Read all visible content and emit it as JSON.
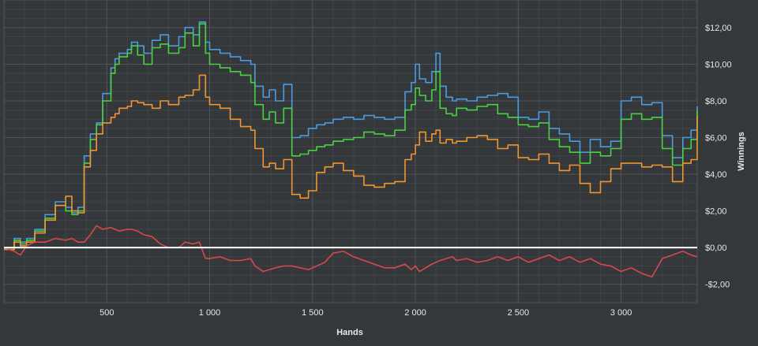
{
  "colors": {
    "background": "#35383b",
    "plot_background": "#35383b",
    "grid_major": "#505458",
    "grid_minor": "#414447",
    "axis_text": "#e8e8e8",
    "zero_line": "#ffffff"
  },
  "chart_data": {
    "type": "line",
    "xlabel": "Hands",
    "ylabel": "Winnings",
    "xlim": [
      0,
      3370
    ],
    "ylim": [
      -3.0,
      13.5
    ],
    "x_ticks": [
      500,
      1000,
      1500,
      2000,
      2500,
      3000
    ],
    "x_tick_labels": [
      "500",
      "1 000",
      "1 500",
      "2 000",
      "2 500",
      "3 000"
    ],
    "y_ticks": [
      -2,
      0,
      2,
      4,
      6,
      8,
      10,
      12
    ],
    "y_tick_labels": [
      "-$2,00",
      "$0,00",
      "$2,00",
      "$4,00",
      "$6,00",
      "$8,00",
      "$10,00",
      "$12,00"
    ],
    "y_axis_side": "right",
    "grid": true,
    "legend": "none",
    "zero_line": true,
    "series": [
      {
        "color": "#4a9be0",
        "step": true,
        "x": [
          0,
          50,
          80,
          110,
          150,
          200,
          250,
          300,
          330,
          360,
          390,
          420,
          450,
          480,
          520,
          540,
          560,
          600,
          620,
          650,
          680,
          720,
          760,
          800,
          850,
          880,
          920,
          950,
          980,
          1000,
          1050,
          1100,
          1150,
          1200,
          1220,
          1260,
          1290,
          1320,
          1360,
          1400,
          1440,
          1480,
          1520,
          1560,
          1600,
          1650,
          1700,
          1750,
          1800,
          1850,
          1900,
          1950,
          1980,
          2000,
          2020,
          2050,
          2080,
          2100,
          2120,
          2150,
          2180,
          2200,
          2250,
          2300,
          2350,
          2400,
          2450,
          2500,
          2550,
          2600,
          2650,
          2700,
          2750,
          2800,
          2850,
          2900,
          2950,
          3000,
          3050,
          3100,
          3150,
          3200,
          3250,
          3300,
          3340,
          3370
        ],
        "y": [
          0.0,
          0.5,
          0.3,
          0.5,
          1.0,
          1.8,
          2.5,
          2.2,
          1.9,
          2.2,
          5.0,
          6.2,
          6.8,
          8.4,
          9.8,
          10.3,
          10.6,
          10.8,
          11.2,
          11.0,
          10.6,
          11.3,
          11.6,
          11.0,
          11.5,
          12.0,
          11.6,
          12.3,
          11.2,
          10.8,
          10.6,
          10.4,
          10.2,
          10.0,
          8.8,
          8.2,
          8.6,
          8.0,
          8.9,
          6.0,
          6.1,
          6.5,
          6.7,
          6.8,
          7.0,
          7.1,
          7.0,
          7.2,
          7.1,
          7.0,
          7.1,
          8.5,
          9.0,
          10.0,
          9.2,
          9.0,
          9.6,
          10.6,
          8.8,
          8.2,
          8.0,
          8.1,
          8.0,
          8.2,
          8.3,
          8.4,
          8.2,
          7.1,
          7.0,
          7.4,
          6.5,
          6.2,
          5.8,
          5.2,
          5.9,
          5.5,
          5.8,
          8.0,
          8.2,
          7.8,
          7.9,
          6.1,
          4.9,
          6.0,
          6.4,
          7.7
        ]
      },
      {
        "color": "#49d140",
        "step": true,
        "x": [
          0,
          50,
          80,
          110,
          150,
          200,
          250,
          300,
          330,
          360,
          390,
          420,
          450,
          480,
          520,
          540,
          560,
          600,
          620,
          650,
          680,
          720,
          760,
          800,
          850,
          880,
          920,
          950,
          980,
          1000,
          1050,
          1100,
          1150,
          1200,
          1220,
          1260,
          1290,
          1320,
          1360,
          1400,
          1440,
          1480,
          1520,
          1560,
          1600,
          1650,
          1700,
          1750,
          1800,
          1850,
          1900,
          1950,
          1980,
          2000,
          2020,
          2050,
          2080,
          2100,
          2120,
          2150,
          2180,
          2200,
          2250,
          2300,
          2350,
          2400,
          2450,
          2500,
          2550,
          2600,
          2650,
          2700,
          2750,
          2800,
          2850,
          2900,
          2950,
          3000,
          3050,
          3100,
          3150,
          3200,
          3250,
          3300,
          3340,
          3370
        ],
        "y": [
          -0.1,
          0.4,
          0.2,
          0.4,
          0.9,
          1.6,
          2.3,
          2.0,
          1.8,
          2.0,
          4.6,
          5.9,
          6.7,
          8.0,
          9.5,
          10.0,
          10.4,
          10.6,
          11.0,
          10.5,
          10.0,
          10.9,
          11.1,
          10.6,
          10.9,
          11.7,
          11.0,
          12.2,
          10.6,
          10.0,
          9.8,
          9.6,
          9.4,
          9.0,
          7.8,
          7.0,
          7.4,
          6.8,
          7.6,
          5.0,
          5.1,
          5.3,
          5.5,
          5.6,
          5.8,
          5.9,
          6.0,
          6.3,
          6.2,
          6.1,
          6.4,
          7.5,
          7.8,
          8.7,
          8.3,
          8.0,
          8.6,
          9.6,
          7.6,
          7.3,
          7.2,
          7.6,
          7.5,
          7.7,
          7.8,
          7.3,
          7.1,
          6.7,
          6.6,
          6.8,
          5.9,
          5.5,
          5.2,
          4.6,
          5.2,
          5.0,
          5.4,
          7.0,
          7.3,
          7.0,
          7.1,
          5.4,
          4.5,
          5.4,
          5.9,
          7.5
        ]
      },
      {
        "color": "#f2952f",
        "step": true,
        "x": [
          0,
          50,
          80,
          110,
          150,
          200,
          250,
          300,
          330,
          360,
          390,
          420,
          450,
          480,
          520,
          540,
          560,
          600,
          620,
          650,
          680,
          720,
          760,
          800,
          850,
          880,
          920,
          950,
          980,
          1000,
          1050,
          1100,
          1150,
          1200,
          1220,
          1260,
          1290,
          1320,
          1360,
          1400,
          1440,
          1480,
          1520,
          1560,
          1600,
          1650,
          1700,
          1750,
          1800,
          1850,
          1900,
          1950,
          1980,
          2000,
          2020,
          2050,
          2080,
          2100,
          2120,
          2150,
          2180,
          2200,
          2250,
          2300,
          2350,
          2400,
          2450,
          2500,
          2550,
          2600,
          2650,
          2700,
          2750,
          2800,
          2850,
          2900,
          2950,
          3000,
          3050,
          3100,
          3150,
          3200,
          3250,
          3300,
          3340,
          3370
        ],
        "y": [
          -0.1,
          0.3,
          0.1,
          0.3,
          0.8,
          1.5,
          2.3,
          2.8,
          2.0,
          1.9,
          4.4,
          5.3,
          6.2,
          6.8,
          7.1,
          7.3,
          7.6,
          7.7,
          8.0,
          7.9,
          7.8,
          7.6,
          8.0,
          7.8,
          8.2,
          8.3,
          8.6,
          9.4,
          8.2,
          7.8,
          7.6,
          7.0,
          6.6,
          6.4,
          5.4,
          4.4,
          4.6,
          4.3,
          4.8,
          2.9,
          2.7,
          3.1,
          4.1,
          4.4,
          4.6,
          4.2,
          3.9,
          3.4,
          3.3,
          3.5,
          3.6,
          4.8,
          5.1,
          5.6,
          6.3,
          5.8,
          6.2,
          6.4,
          5.7,
          5.9,
          5.7,
          5.8,
          6.0,
          6.1,
          5.9,
          5.4,
          5.6,
          4.9,
          4.8,
          5.1,
          4.6,
          4.2,
          4.5,
          3.5,
          3.0,
          3.6,
          4.3,
          4.6,
          4.6,
          4.4,
          4.5,
          4.4,
          3.6,
          4.6,
          4.8,
          7.2
        ]
      },
      {
        "color": "#d94848",
        "step": false,
        "x": [
          0,
          50,
          80,
          110,
          150,
          200,
          250,
          300,
          330,
          360,
          390,
          420,
          450,
          480,
          520,
          540,
          560,
          600,
          620,
          650,
          680,
          720,
          760,
          800,
          850,
          880,
          920,
          950,
          980,
          1000,
          1050,
          1100,
          1150,
          1200,
          1220,
          1260,
          1290,
          1320,
          1360,
          1400,
          1440,
          1480,
          1520,
          1560,
          1600,
          1650,
          1700,
          1750,
          1800,
          1850,
          1900,
          1950,
          1980,
          2000,
          2020,
          2050,
          2080,
          2100,
          2120,
          2150,
          2180,
          2200,
          2250,
          2300,
          2350,
          2400,
          2450,
          2500,
          2550,
          2600,
          2650,
          2700,
          2750,
          2800,
          2850,
          2900,
          2950,
          3000,
          3050,
          3100,
          3150,
          3200,
          3250,
          3300,
          3340,
          3370
        ],
        "y": [
          0.0,
          -0.2,
          -0.4,
          0.1,
          0.3,
          0.3,
          0.5,
          0.4,
          0.5,
          0.3,
          0.3,
          0.7,
          1.2,
          1.0,
          1.1,
          1.0,
          0.9,
          1.0,
          1.0,
          0.9,
          0.7,
          0.6,
          0.2,
          0.0,
          0.0,
          0.3,
          0.2,
          0.3,
          -0.6,
          -0.6,
          -0.5,
          -0.7,
          -0.7,
          -0.6,
          -1.0,
          -1.3,
          -1.2,
          -1.1,
          -1.0,
          -1.0,
          -1.1,
          -1.2,
          -1.0,
          -0.8,
          -0.3,
          -0.2,
          -0.5,
          -0.7,
          -0.9,
          -1.1,
          -1.1,
          -0.9,
          -1.2,
          -1.0,
          -1.3,
          -1.1,
          -0.9,
          -0.8,
          -0.7,
          -0.6,
          -0.5,
          -0.7,
          -0.6,
          -0.8,
          -0.7,
          -0.5,
          -0.7,
          -0.5,
          -0.8,
          -0.6,
          -0.4,
          -0.7,
          -0.5,
          -0.8,
          -0.6,
          -0.9,
          -1.0,
          -1.3,
          -1.1,
          -1.4,
          -1.6,
          -0.6,
          -0.4,
          -0.2,
          -0.4,
          -0.5
        ]
      }
    ]
  }
}
